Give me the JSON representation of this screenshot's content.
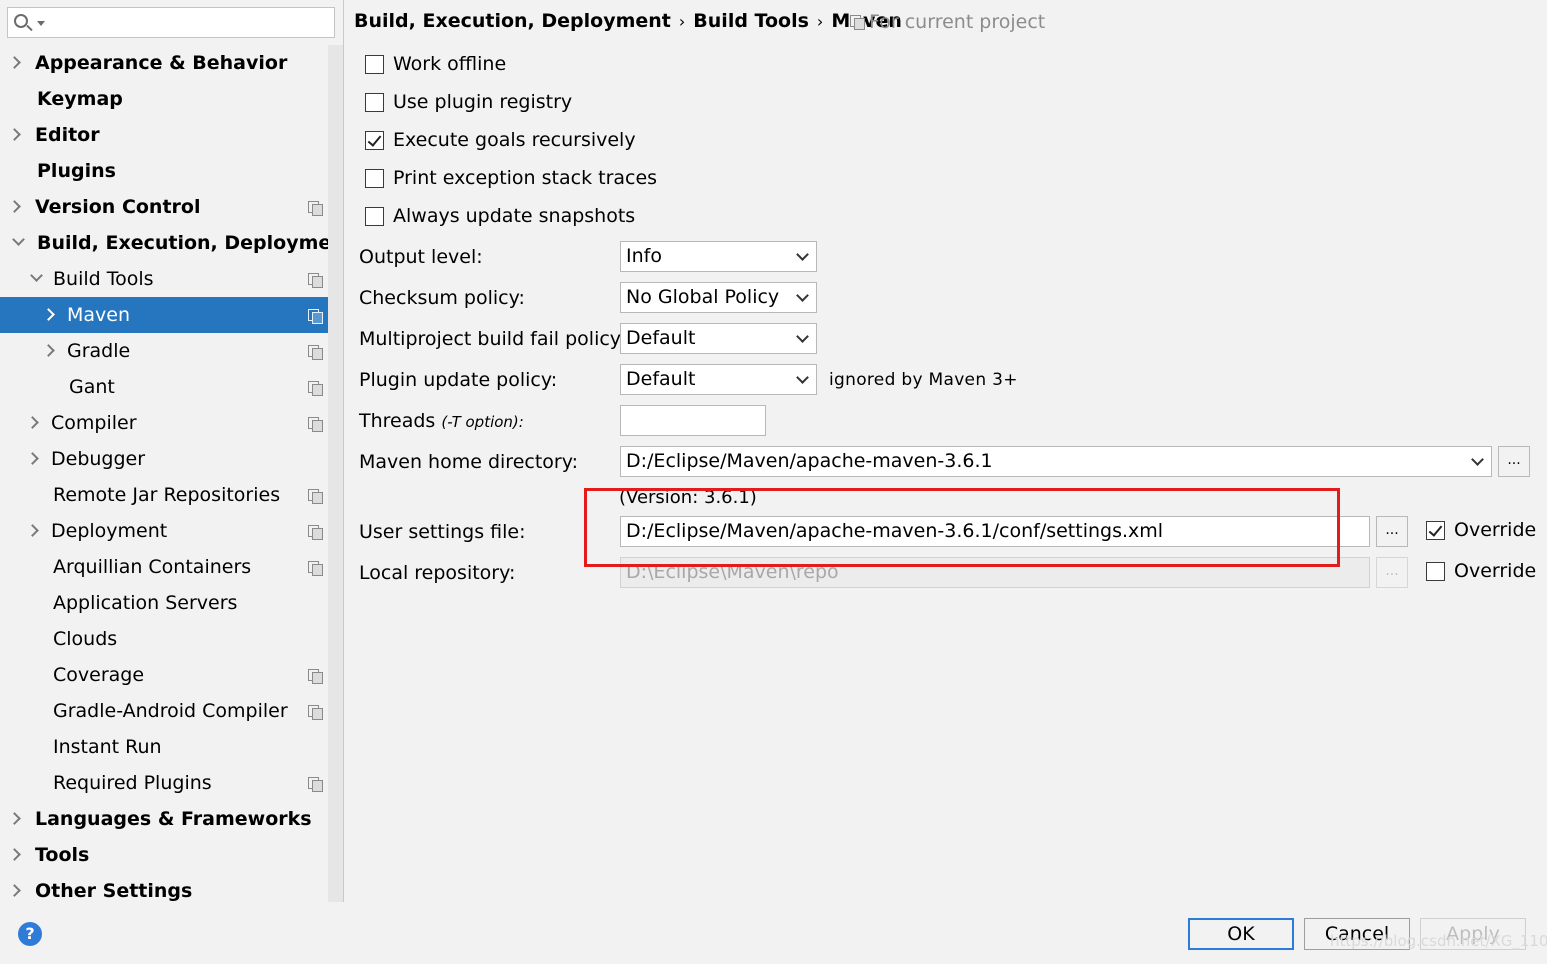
{
  "search": {
    "placeholder": ""
  },
  "sidebar": {
    "items": [
      {
        "label": "Appearance & Behavior",
        "bold": true,
        "arrow": "right"
      },
      {
        "label": "Keymap",
        "bold": true
      },
      {
        "label": "Editor",
        "bold": true,
        "arrow": "right"
      },
      {
        "label": "Plugins",
        "bold": true
      },
      {
        "label": "Version Control",
        "bold": true,
        "arrow": "right",
        "project_icon": true
      },
      {
        "label": "Build, Execution, Deployment",
        "bold": true,
        "arrow": "down"
      },
      {
        "label": "Build Tools",
        "arrow": "down",
        "project_icon": true
      },
      {
        "label": "Maven",
        "arrow": "right",
        "project_icon": true,
        "selected": true
      },
      {
        "label": "Gradle",
        "arrow": "right",
        "project_icon": true
      },
      {
        "label": "Gant",
        "project_icon": true
      },
      {
        "label": "Compiler",
        "arrow": "right",
        "project_icon": true
      },
      {
        "label": "Debugger",
        "arrow": "right"
      },
      {
        "label": "Remote Jar Repositories",
        "project_icon": true
      },
      {
        "label": "Deployment",
        "arrow": "right",
        "project_icon": true
      },
      {
        "label": "Arquillian Containers",
        "project_icon": true
      },
      {
        "label": "Application Servers"
      },
      {
        "label": "Clouds"
      },
      {
        "label": "Coverage",
        "project_icon": true
      },
      {
        "label": "Gradle-Android Compiler",
        "project_icon": true
      },
      {
        "label": "Instant Run"
      },
      {
        "label": "Required Plugins",
        "project_icon": true
      },
      {
        "label": "Languages & Frameworks",
        "bold": true,
        "arrow": "right"
      },
      {
        "label": "Tools",
        "bold": true,
        "arrow": "right"
      },
      {
        "label": "Other Settings",
        "bold": true,
        "arrow": "right"
      }
    ]
  },
  "breadcrumb": {
    "parts": [
      "Build, Execution, Deployment",
      "Build Tools",
      "Maven"
    ],
    "separator": "›",
    "scope": "For current project"
  },
  "options": {
    "work_offline": {
      "label": "Work offline",
      "checked": false
    },
    "use_plugin_registry": {
      "label": "Use plugin registry",
      "checked": false
    },
    "execute_goals_recursively": {
      "label": "Execute goals recursively",
      "checked": true
    },
    "print_exception_stack_traces": {
      "label": "Print exception stack traces",
      "checked": false
    },
    "always_update_snapshots": {
      "label": "Always update snapshots",
      "checked": false
    }
  },
  "fields": {
    "output_level": {
      "label": "Output level:",
      "value": "Info"
    },
    "checksum_policy": {
      "label": "Checksum policy:",
      "value": "No Global Policy"
    },
    "multiproject_fail_policy": {
      "label": "Multiproject build fail policy:",
      "value": "Default"
    },
    "plugin_update_policy": {
      "label": "Plugin update policy:",
      "value": "Default",
      "hint": "ignored by Maven 3+"
    },
    "threads": {
      "label": "Threads",
      "option": "(-T option):",
      "value": ""
    },
    "maven_home": {
      "label": "Maven home directory:",
      "value": "D:/Eclipse/Maven/apache-maven-3.6.1",
      "version": "(Version: 3.6.1)",
      "browse": "..."
    },
    "user_settings": {
      "label": "User settings file:",
      "value": "D:/Eclipse/Maven/apache-maven-3.6.1/conf/settings.xml",
      "browse": "...",
      "override_label": "Override",
      "override_checked": true
    },
    "local_repository": {
      "label": "Local repository:",
      "value": "D:\\Eclipse\\Maven\\repo",
      "browse": "...",
      "override_label": "Override",
      "override_checked": false
    }
  },
  "buttons": {
    "help": "?",
    "ok": "OK",
    "cancel": "Cancel",
    "apply": "Apply"
  },
  "watermark": "https://blog.csdn.net/XG_1101",
  "colors": {
    "selection": "#2675bf",
    "highlight_box": "#e21b1b",
    "ok_border": "#2f7bd8"
  }
}
